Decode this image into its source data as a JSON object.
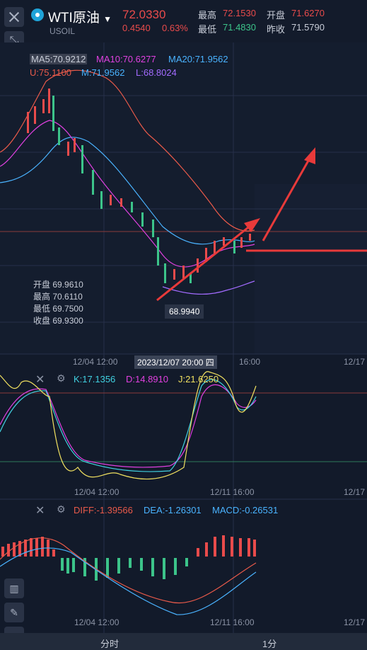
{
  "header": {
    "symbol": "WTI原油",
    "code": "USOIL",
    "price": "72.0330",
    "change": "0.4540",
    "change_pct": "0.63%",
    "stats": [
      {
        "label": "最高",
        "value": "72.1530",
        "color": "#e94b4b"
      },
      {
        "label": "开盘",
        "value": "71.6270",
        "color": "#e94b4b"
      },
      {
        "label": "最低",
        "value": "71.4830",
        "color": "#3cc48a"
      },
      {
        "label": "昨收",
        "value": "71.5790",
        "color": "#c8cdd8"
      }
    ]
  },
  "main_chart": {
    "legend_row1": [
      {
        "text": "MA5:70.9212",
        "color": "#c8cdd8"
      },
      {
        "text": "MA10:70.6277",
        "color": "#e040e0"
      },
      {
        "text": "MA20:71.9562",
        "color": "#4ab3ff"
      }
    ],
    "legend_row2": [
      {
        "text": "U:75.1100",
        "color": "#e95a4a"
      },
      {
        "text": "M:71.9562",
        "color": "#4ab3ff"
      },
      {
        "text": "L:68.8024",
        "color": "#a36bff"
      }
    ],
    "ohlc": [
      {
        "label": "开盘",
        "value": "69.9610"
      },
      {
        "label": "最高",
        "value": "70.6110"
      },
      {
        "label": "最低",
        "value": "69.7500"
      },
      {
        "label": "收盘",
        "value": "69.9300"
      }
    ],
    "low_marker": "68.9940",
    "crosshair_time": "2023/12/07 20:00 四",
    "time_labels": [
      "12/04 12:00",
      "16:00",
      "12/17"
    ]
  },
  "kdj": {
    "k": "K:17.1356",
    "d": "D:14.8910",
    "j": "J:21.6250",
    "time_labels": [
      "12/04 12:00",
      "12/11 16:00",
      "12/17"
    ]
  },
  "macd": {
    "diff": "DIFF:-1.39566",
    "dea": "DEA:-1.26301",
    "macd": "MACD:-0.26531",
    "time_labels": [
      "12/04 12:00",
      "12/11 16:00",
      "12/17"
    ]
  },
  "bottom_bar": {
    "tab1": "分时",
    "tab2": "1分"
  },
  "colors": {
    "up": "#e94b4b",
    "down": "#3cc48a",
    "bg": "#121a2a"
  }
}
